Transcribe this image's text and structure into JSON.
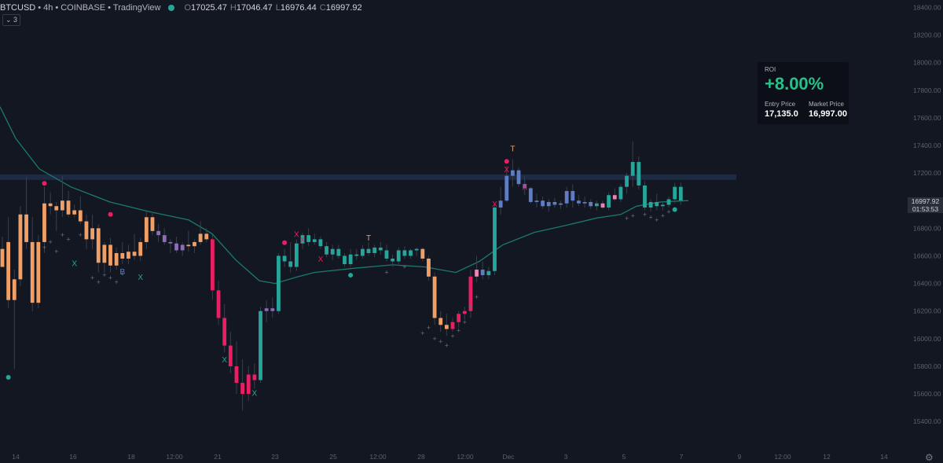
{
  "legend": {
    "symbol": "BTCUSD",
    "sep": "•",
    "interval": "4h",
    "exchange": "COINBASE",
    "source": "TradingView",
    "ohlc": [
      {
        "k": "O",
        "v": "17025.47"
      },
      {
        "k": "H",
        "v": "17046.47"
      },
      {
        "k": "L",
        "v": "16976.44"
      },
      {
        "k": "C",
        "v": "16997.92"
      }
    ],
    "collapse_label": "⌄ 3"
  },
  "roi_panel": {
    "label": "ROI",
    "value": "+8.00%",
    "entry_label": "Entry Price",
    "entry_value": "17,135.0",
    "market_label": "Market Price",
    "market_value": "16,997.00"
  },
  "price_badge": {
    "price": "16997.92",
    "countdown": "01:53:53"
  },
  "colors": {
    "background": "#131722",
    "orange": "#f0a066",
    "teal": "#26a69a",
    "red": "#e91e63",
    "blue": "#5f7cc5",
    "purple": "#8e6db8",
    "pink": "#ef83b8",
    "ema": "#1b7a6c",
    "zone": "#1f2a45"
  },
  "chart_data": {
    "type": "candlestick",
    "y_ticks": [
      "18400.00",
      "18200.00",
      "18000.00",
      "17800.00",
      "17600.00",
      "17400.00",
      "17200.00",
      "17000.00",
      "16800.00",
      "16600.00",
      "16400.00",
      "16200.00",
      "16000.00",
      "15800.00",
      "15600.00",
      "15400.00"
    ],
    "x_ticks": [
      "14",
      "16",
      "18",
      "12:00",
      "21",
      "23",
      "25",
      "12:00",
      "28",
      "12:00",
      "Dec",
      "3",
      "5",
      "7",
      "9",
      "12:00",
      "12",
      "14"
    ],
    "ylim": [
      15300,
      18500
    ],
    "current_price": 16997.92,
    "resistance_zone": [
      17150,
      17190
    ],
    "ema": [
      [
        0,
        17680
      ],
      [
        20,
        17450
      ],
      [
        50,
        17230
      ],
      [
        90,
        17100
      ],
      [
        140,
        16990
      ],
      [
        190,
        16920
      ],
      [
        240,
        16860
      ],
      [
        270,
        16760
      ],
      [
        300,
        16570
      ],
      [
        330,
        16420
      ],
      [
        350,
        16400
      ],
      [
        380,
        16450
      ],
      [
        400,
        16480
      ],
      [
        450,
        16510
      ],
      [
        500,
        16535
      ],
      [
        540,
        16520
      ],
      [
        580,
        16480
      ],
      [
        610,
        16560
      ],
      [
        640,
        16680
      ],
      [
        680,
        16770
      ],
      [
        720,
        16820
      ],
      [
        760,
        16875
      ],
      [
        790,
        16900
      ],
      [
        810,
        16960
      ],
      [
        840,
        16990
      ],
      [
        876,
        17000
      ]
    ],
    "candles": [
      [
        16650,
        16740,
        16550,
        16520
      ],
      [
        16700,
        16880,
        16220,
        16280
      ],
      [
        16280,
        16500,
        15780,
        16430
      ],
      [
        16430,
        16960,
        16380,
        16900
      ],
      [
        16900,
        17170,
        16650,
        16700
      ],
      [
        16700,
        16880,
        16200,
        16260
      ],
      [
        16260,
        16750,
        16220,
        16700
      ],
      [
        16700,
        17100,
        16620,
        16980
      ],
      [
        16980,
        17060,
        16900,
        16960
      ],
      [
        16960,
        16990,
        16780,
        16930
      ],
      [
        16930,
        17180,
        16880,
        17000
      ],
      [
        17000,
        17070,
        16880,
        16900
      ],
      [
        16900,
        16970,
        16880,
        16930
      ],
      [
        16930,
        17030,
        16830,
        16850
      ],
      [
        16850,
        16900,
        16650,
        16720
      ],
      [
        16720,
        16900,
        16650,
        16800
      ],
      [
        16800,
        16830,
        16480,
        16550
      ],
      [
        16550,
        16700,
        16480,
        16680
      ],
      [
        16680,
        16730,
        16480,
        16530
      ],
      [
        16530,
        16660,
        16500,
        16620
      ],
      [
        16620,
        16700,
        16540,
        16580
      ],
      [
        16580,
        16680,
        16540,
        16630
      ],
      [
        16630,
        16760,
        16570,
        16600
      ],
      [
        16600,
        16730,
        16560,
        16700
      ],
      [
        16700,
        16920,
        16650,
        16880
      ],
      [
        16880,
        16920,
        16750,
        16780
      ],
      [
        16780,
        16830,
        16700,
        16750,
        1
      ],
      [
        16750,
        16800,
        16680,
        16700,
        1
      ],
      [
        16700,
        16720,
        16620,
        16690,
        2
      ],
      [
        16690,
        16740,
        16620,
        16640,
        2
      ],
      [
        16640,
        16700,
        16600,
        16680,
        1
      ],
      [
        16680,
        16780,
        16630,
        16670
      ],
      [
        16670,
        16720,
        16620,
        16700
      ],
      [
        16700,
        16850,
        16680,
        16760
      ],
      [
        16760,
        16800,
        16700,
        16720
      ],
      [
        16720,
        16750,
        16280,
        16350
      ],
      [
        16350,
        16420,
        16100,
        16150
      ],
      [
        16150,
        16250,
        15900,
        15950
      ],
      [
        15950,
        16050,
        15750,
        15800
      ],
      [
        15800,
        15980,
        15600,
        15680
      ],
      [
        15680,
        15850,
        15480,
        15600
      ],
      [
        15600,
        15800,
        15550,
        15740
      ],
      [
        15740,
        15820,
        15640,
        15700
      ],
      [
        15700,
        16230,
        15680,
        16200
      ],
      [
        16200,
        16280,
        16120,
        16220,
        2
      ],
      [
        16220,
        16300,
        16150,
        16200,
        2
      ],
      [
        16200,
        16620,
        16180,
        16600
      ],
      [
        16600,
        16650,
        16520,
        16560
      ],
      [
        16560,
        16700,
        16480,
        16520
      ],
      [
        16520,
        16720,
        16490,
        16690
      ],
      [
        16690,
        16770,
        16650,
        16750
      ],
      [
        16750,
        16800,
        16670,
        16700
      ],
      [
        16700,
        16760,
        16680,
        16720
      ],
      [
        16720,
        16740,
        16650,
        16670
      ],
      [
        16670,
        16700,
        16590,
        16610
      ],
      [
        16610,
        16680,
        16570,
        16650
      ],
      [
        16650,
        16680,
        16580,
        16600
      ],
      [
        16600,
        16620,
        16520,
        16540
      ],
      [
        16540,
        16650,
        16520,
        16610
      ],
      [
        16610,
        16650,
        16570,
        16600
      ],
      [
        16600,
        16680,
        16580,
        16650
      ],
      [
        16650,
        16700,
        16600,
        16620
      ],
      [
        16620,
        16680,
        16590,
        16660
      ],
      [
        16660,
        16700,
        16610,
        16640
      ],
      [
        16640,
        16680,
        16560,
        16580
      ],
      [
        16580,
        16610,
        16520,
        16560
      ],
      [
        16560,
        16660,
        16540,
        16640
      ],
      [
        16640,
        16670,
        16580,
        16600
      ],
      [
        16600,
        16650,
        16580,
        16640
      ],
      [
        16640,
        16660,
        16600,
        16650
      ],
      [
        16650,
        16660,
        16560,
        16580
      ],
      [
        16580,
        16600,
        16420,
        16450
      ],
      [
        16450,
        16480,
        16100,
        16150
      ],
      [
        16150,
        16200,
        16050,
        16100
      ],
      [
        16100,
        16180,
        16020,
        16070
      ],
      [
        16070,
        16150,
        16050,
        16120
      ],
      [
        16120,
        16200,
        16080,
        16180
      ],
      [
        16180,
        16230,
        16140,
        16200
      ],
      [
        16200,
        16500,
        16150,
        16450
      ],
      [
        16450,
        16600,
        16410,
        16500,
        4
      ],
      [
        16500,
        16560,
        16430,
        16460,
        3
      ],
      [
        16460,
        16520,
        16430,
        16490
      ],
      [
        16490,
        16980,
        16460,
        16950
      ],
      [
        16950,
        17100,
        16900,
        17000,
        3
      ],
      [
        17000,
        17250,
        16990,
        17180,
        3
      ],
      [
        17180,
        17300,
        17100,
        17220,
        3
      ],
      [
        17220,
        17240,
        17100,
        17120,
        3
      ],
      [
        17120,
        17180,
        17040,
        17090,
        3
      ],
      [
        17090,
        17100,
        16980,
        16990,
        3
      ],
      [
        16990,
        17050,
        16950,
        17000,
        3
      ],
      [
        17000,
        17030,
        16940,
        16960,
        3
      ],
      [
        16960,
        17010,
        16920,
        16990,
        3
      ],
      [
        16990,
        17020,
        16950,
        16970,
        3
      ],
      [
        16970,
        17000,
        16940,
        16980,
        3
      ],
      [
        16980,
        17100,
        16950,
        17070,
        3
      ],
      [
        17070,
        17120,
        16950,
        17000,
        3
      ],
      [
        17000,
        17040,
        16960,
        16980,
        3
      ],
      [
        16980,
        17030,
        16950,
        16990,
        3
      ],
      [
        16990,
        17010,
        16940,
        16960,
        3
      ],
      [
        16960,
        17000,
        16930,
        16980
      ],
      [
        16980,
        17000,
        16940,
        16950,
        4
      ],
      [
        16950,
        17060,
        16930,
        17040
      ],
      [
        17040,
        17090,
        17000,
        17010,
        4
      ],
      [
        17010,
        17120,
        16990,
        17100
      ],
      [
        17100,
        17200,
        17050,
        17180
      ],
      [
        17180,
        17430,
        17100,
        17280
      ],
      [
        17280,
        17320,
        17080,
        17110
      ],
      [
        17110,
        17140,
        16930,
        16950
      ],
      [
        16950,
        17010,
        16920,
        16990
      ],
      [
        16990,
        17050,
        16930,
        16960
      ],
      [
        16960,
        16990,
        16930,
        16970
      ],
      [
        16970,
        17030,
        16950,
        17010
      ],
      [
        17010,
        17130,
        16980,
        17100
      ],
      [
        17100,
        17130,
        16970,
        17000
      ]
    ],
    "markers": [
      {
        "label": "X",
        "i": 12,
        "p": 16550,
        "color": "teal"
      },
      {
        "label": "B",
        "i": 20,
        "p": 16490,
        "color": "blue"
      },
      {
        "label": "X",
        "i": 23,
        "p": 16450,
        "color": "teal"
      },
      {
        "label": "X",
        "i": 37,
        "p": 15850,
        "color": "teal"
      },
      {
        "label": "X",
        "i": 42,
        "p": 15610,
        "color": "teal"
      },
      {
        "label": "X",
        "i": 49,
        "p": 16760,
        "color": "red"
      },
      {
        "label": "X",
        "i": 50,
        "p": 16720,
        "color": "red"
      },
      {
        "label": "X",
        "i": 53,
        "p": 16580,
        "color": "red"
      },
      {
        "label": "T",
        "i": 61,
        "p": 16735,
        "color": "orange"
      },
      {
        "label": "X",
        "i": 82,
        "p": 16980,
        "color": "red"
      },
      {
        "label": "X",
        "i": 84,
        "p": 17230,
        "color": "red"
      },
      {
        "label": "T",
        "i": 85,
        "p": 17380,
        "color": "orange"
      },
      {
        "label": "X",
        "i": 87,
        "p": 17100,
        "color": "red"
      }
    ],
    "dots": [
      {
        "i": 1,
        "p": 15720,
        "color": "teal"
      },
      {
        "i": 7,
        "p": 17125,
        "color": "red"
      },
      {
        "i": 18,
        "p": 16900,
        "color": "red"
      },
      {
        "i": 47,
        "p": 16695,
        "color": "red"
      },
      {
        "i": 58,
        "p": 16460,
        "color": "teal"
      },
      {
        "i": 84,
        "p": 17285,
        "color": "red"
      },
      {
        "i": 112,
        "p": 16935,
        "color": "teal"
      }
    ],
    "cross_stops": [
      [
        7,
        16660
      ],
      [
        8,
        16700
      ],
      [
        9,
        16630
      ],
      [
        10,
        16750
      ],
      [
        11,
        16720
      ],
      [
        13,
        16750
      ],
      [
        15,
        16440
      ],
      [
        16,
        16410
      ],
      [
        17,
        16460
      ],
      [
        18,
        16440
      ],
      [
        19,
        16410
      ],
      [
        20,
        16470
      ],
      [
        64,
        16480
      ],
      [
        67,
        16520
      ],
      [
        70,
        16040
      ],
      [
        71,
        16080
      ],
      [
        72,
        16000
      ],
      [
        73,
        15980
      ],
      [
        74,
        15950
      ],
      [
        75,
        16020
      ],
      [
        76,
        16060
      ],
      [
        77,
        16120
      ],
      [
        78,
        16230
      ],
      [
        79,
        16300
      ],
      [
        104,
        16870
      ],
      [
        105,
        16890
      ],
      [
        107,
        16900
      ],
      [
        108,
        16880
      ],
      [
        109,
        16860
      ],
      [
        110,
        16890
      ],
      [
        111,
        16920
      ]
    ]
  }
}
